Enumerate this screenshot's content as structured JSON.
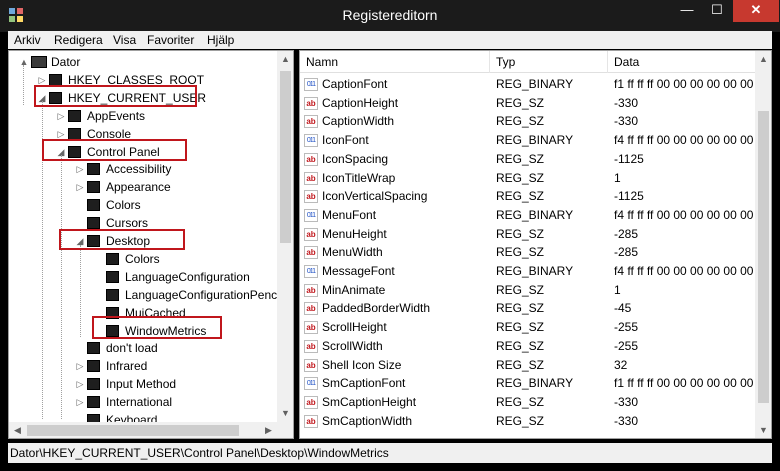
{
  "window": {
    "title": "Registereditorn",
    "min_glyph": "—",
    "max_glyph": "☐",
    "close_glyph": "✕"
  },
  "menu": [
    "Arkiv",
    "Redigera",
    "Visa",
    "Favoriter",
    "Hjälp"
  ],
  "tree": [
    {
      "label": "Dator",
      "level": 0,
      "arrow": "▲",
      "type": "pc"
    },
    {
      "label": "HKEY_CLASSES_ROOT",
      "level": 1,
      "arrow": "▷"
    },
    {
      "label": "HKEY_CURRENT_USER",
      "level": 1,
      "arrow": "◢"
    },
    {
      "label": "AppEvents",
      "level": 2,
      "arrow": "▷"
    },
    {
      "label": "Console",
      "level": 2,
      "arrow": "▷"
    },
    {
      "label": "Control Panel",
      "level": 2,
      "arrow": "◢"
    },
    {
      "label": "Accessibility",
      "level": 3,
      "arrow": "▷"
    },
    {
      "label": "Appearance",
      "level": 3,
      "arrow": "▷"
    },
    {
      "label": "Colors",
      "level": 3,
      "arrow": ""
    },
    {
      "label": "Cursors",
      "level": 3,
      "arrow": ""
    },
    {
      "label": "Desktop",
      "level": 3,
      "arrow": "◢"
    },
    {
      "label": "Colors",
      "level": 4,
      "arrow": ""
    },
    {
      "label": "LanguageConfiguration",
      "level": 4,
      "arrow": ""
    },
    {
      "label": "LanguageConfigurationPenc",
      "level": 4,
      "arrow": ""
    },
    {
      "label": "MuiCached",
      "level": 4,
      "arrow": ""
    },
    {
      "label": "WindowMetrics",
      "level": 4,
      "arrow": ""
    },
    {
      "label": "don't load",
      "level": 3,
      "arrow": ""
    },
    {
      "label": "Infrared",
      "level": 3,
      "arrow": "▷"
    },
    {
      "label": "Input Method",
      "level": 3,
      "arrow": "▷"
    },
    {
      "label": "International",
      "level": 3,
      "arrow": "▷"
    },
    {
      "label": "Keyboard",
      "level": 3,
      "arrow": ""
    }
  ],
  "columns": [
    "Namn",
    "Typ",
    "Data"
  ],
  "rows": [
    {
      "icon": "bin",
      "name": "CaptionFont",
      "type": "REG_BINARY",
      "data": "f1 ff ff ff 00 00 00 00 00 00 0"
    },
    {
      "icon": "sz",
      "name": "CaptionHeight",
      "type": "REG_SZ",
      "data": "-330"
    },
    {
      "icon": "sz",
      "name": "CaptionWidth",
      "type": "REG_SZ",
      "data": "-330"
    },
    {
      "icon": "bin",
      "name": "IconFont",
      "type": "REG_BINARY",
      "data": "f4 ff ff ff 00 00 00 00 00 00 0"
    },
    {
      "icon": "sz",
      "name": "IconSpacing",
      "type": "REG_SZ",
      "data": "-1125"
    },
    {
      "icon": "sz",
      "name": "IconTitleWrap",
      "type": "REG_SZ",
      "data": "1"
    },
    {
      "icon": "sz",
      "name": "IconVerticalSpacing",
      "type": "REG_SZ",
      "data": "-1125"
    },
    {
      "icon": "bin",
      "name": "MenuFont",
      "type": "REG_BINARY",
      "data": "f4 ff ff ff 00 00 00 00 00 00 0"
    },
    {
      "icon": "sz",
      "name": "MenuHeight",
      "type": "REG_SZ",
      "data": "-285"
    },
    {
      "icon": "sz",
      "name": "MenuWidth",
      "type": "REG_SZ",
      "data": "-285"
    },
    {
      "icon": "bin",
      "name": "MessageFont",
      "type": "REG_BINARY",
      "data": "f4 ff ff ff 00 00 00 00 00 00 0"
    },
    {
      "icon": "sz",
      "name": "MinAnimate",
      "type": "REG_SZ",
      "data": "1"
    },
    {
      "icon": "sz",
      "name": "PaddedBorderWidth",
      "type": "REG_SZ",
      "data": "-45"
    },
    {
      "icon": "sz",
      "name": "ScrollHeight",
      "type": "REG_SZ",
      "data": "-255"
    },
    {
      "icon": "sz",
      "name": "ScrollWidth",
      "type": "REG_SZ",
      "data": "-255"
    },
    {
      "icon": "sz",
      "name": "Shell Icon Size",
      "type": "REG_SZ",
      "data": "32"
    },
    {
      "icon": "bin",
      "name": "SmCaptionFont",
      "type": "REG_BINARY",
      "data": "f1 ff ff ff 00 00 00 00 00 00 0"
    },
    {
      "icon": "sz",
      "name": "SmCaptionHeight",
      "type": "REG_SZ",
      "data": "-330"
    },
    {
      "icon": "sz",
      "name": "SmCaptionWidth",
      "type": "REG_SZ",
      "data": "-330"
    }
  ],
  "icons": {
    "sz": "ab",
    "bin": "011"
  },
  "status": "Dator\\HKEY_CURRENT_USER\\Control Panel\\Desktop\\WindowMetrics",
  "colors": {
    "highlight": "#c0161c",
    "close": "#c7392f"
  }
}
